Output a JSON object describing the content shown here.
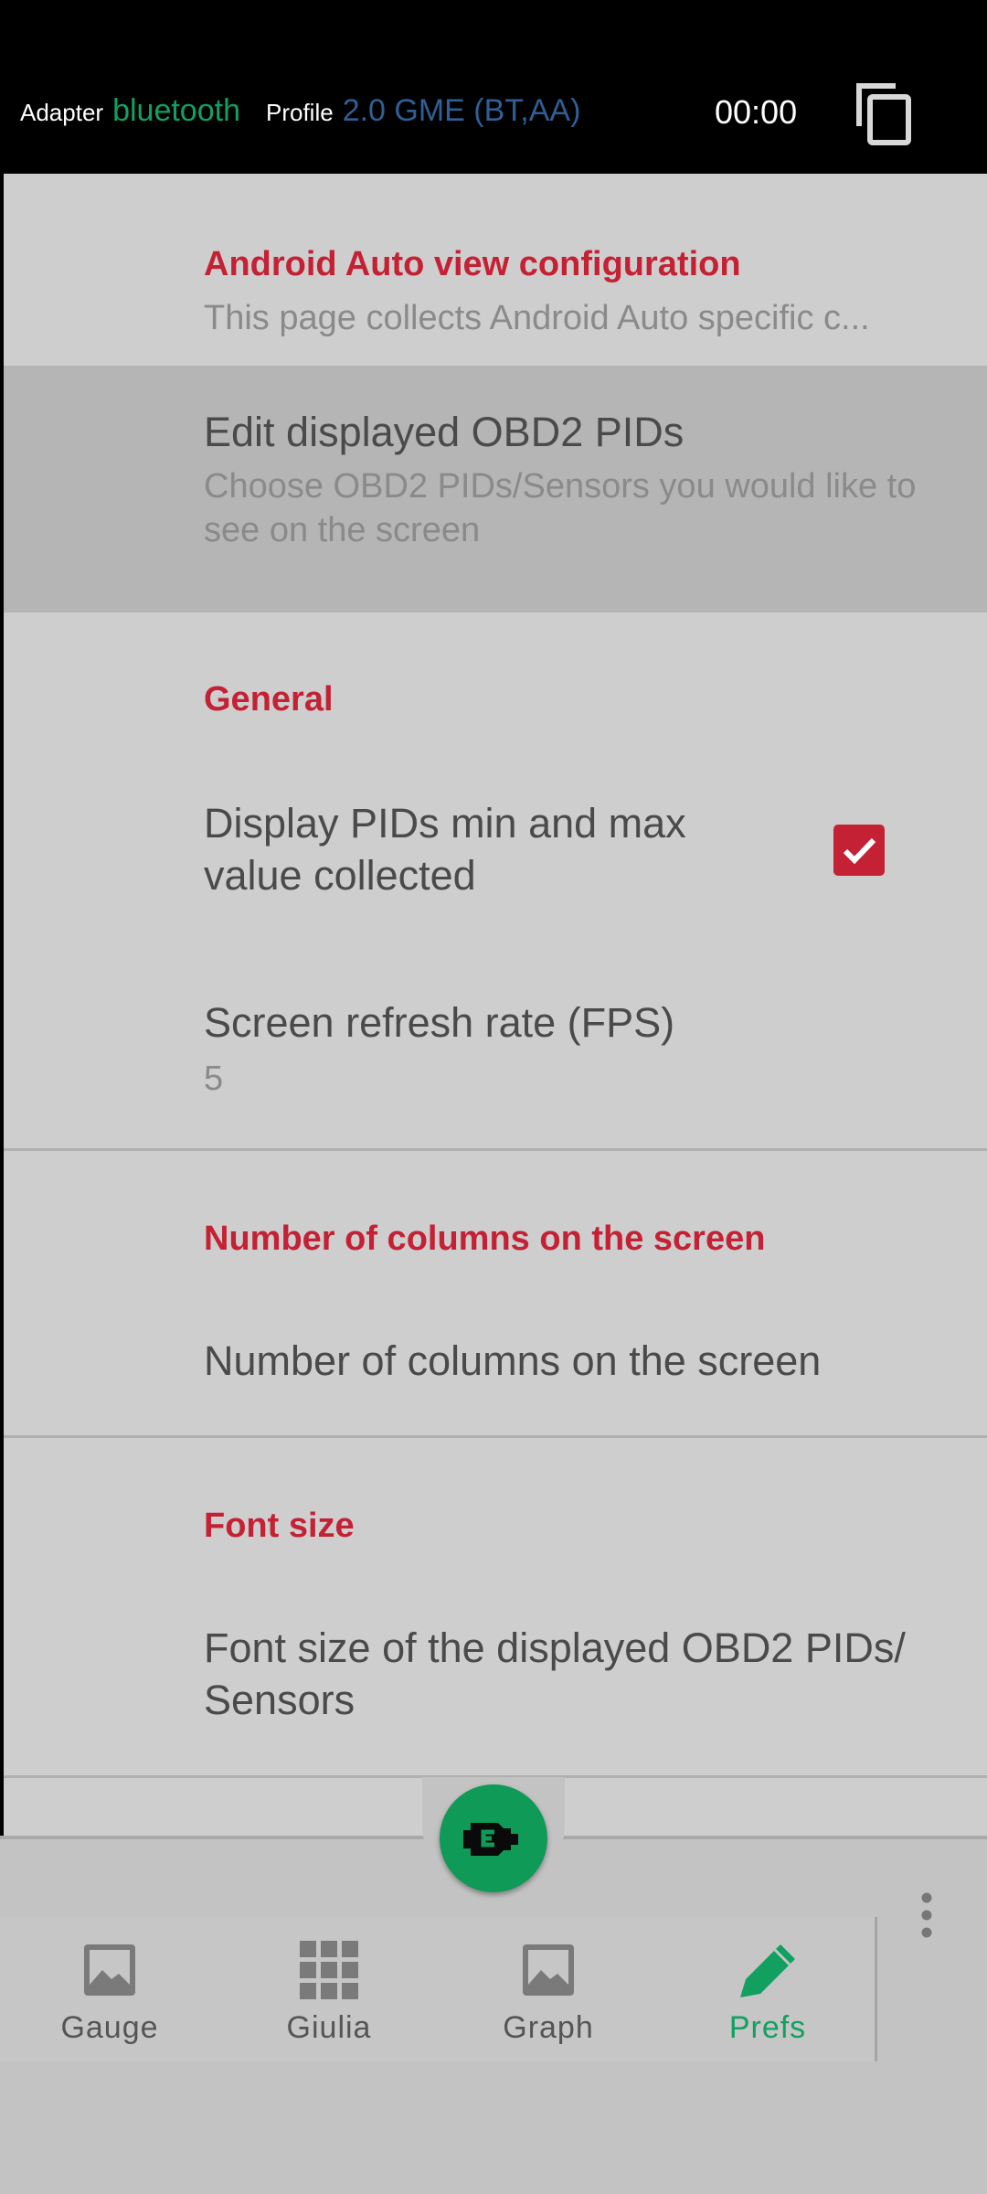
{
  "topbar": {
    "adapter_label": "Adapter",
    "adapter_value": "bluetooth",
    "profile_label": "Profile",
    "profile_value": "2.0 GME (BT,AA)",
    "timer": "00:00",
    "copy_icon": "copy-icon"
  },
  "prefs": {
    "android_auto": {
      "section_title": "Android Auto view configuration",
      "section_desc": "This page collects Android Auto specific c..."
    },
    "edit_pids": {
      "title": "Edit displayed OBD2 PIDs",
      "summary": "Choose OBD2 PIDs/Sensors you would like to see on the screen"
    },
    "general": {
      "section_title": "General",
      "min_max_title": "Display PIDs min and max value collected",
      "min_max_checked": true,
      "fps_title": "Screen refresh rate (FPS)",
      "fps_value": "5"
    },
    "columns": {
      "section_title": "Number of columns on the screen",
      "item_title": "Number of columns on the screen"
    },
    "font_size": {
      "section_title": "Font size",
      "item_title": "Font size of the displayed OBD2 PIDs/ Sensors"
    }
  },
  "fab": {
    "icon": "engine-icon"
  },
  "bottom_nav": {
    "items": [
      {
        "label": "Gauge",
        "icon": "image-icon",
        "active": false
      },
      {
        "label": "Giulia",
        "icon": "grid-icon",
        "active": false
      },
      {
        "label": "Graph",
        "icon": "image-icon",
        "active": false
      },
      {
        "label": "Prefs",
        "icon": "pencil-icon",
        "active": true
      }
    ],
    "more_icon": "more-vert-icon"
  },
  "colors": {
    "accent_red": "#c42134",
    "accent_green": "#12a061",
    "profile_blue": "#2f5f95",
    "toolbar_bg": "#000000"
  }
}
